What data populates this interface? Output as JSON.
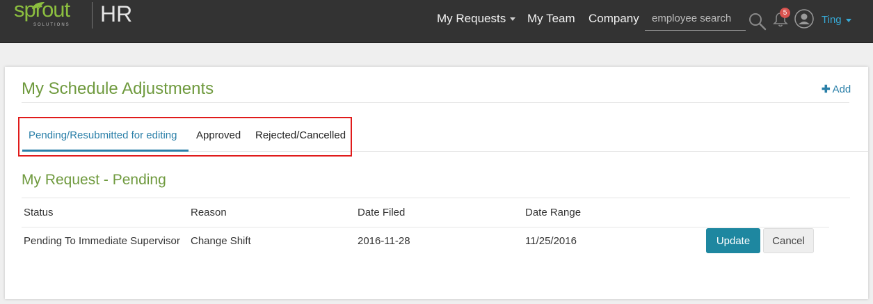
{
  "app": {
    "logo_text": "sprout",
    "logo_sub": "SOLUTIONS",
    "logo_product": "HR"
  },
  "nav": {
    "my_requests": "My Requests",
    "my_team": "My Team",
    "company": "Company",
    "search_placeholder": "employee search",
    "notification_count": "5",
    "user_name": "Ting"
  },
  "page": {
    "title": "My Schedule Adjustments",
    "add_label": "Add"
  },
  "tabs": [
    {
      "label": "Pending/Resubmitted for editing",
      "active": true
    },
    {
      "label": "Approved",
      "active": false
    },
    {
      "label": "Rejected/Cancelled",
      "active": false
    }
  ],
  "section": {
    "title": "My Request - Pending"
  },
  "table": {
    "columns": [
      "Status",
      "Reason",
      "Date Filed",
      "Date Range"
    ],
    "rows": [
      {
        "status": "Pending To Immediate Supervisor",
        "reason": "Change Shift",
        "date_filed": "2016-11-28",
        "date_range": "11/25/2016"
      }
    ],
    "update_label": "Update",
    "cancel_label": "Cancel"
  },
  "colors": {
    "topbar": "#333333",
    "brand_green": "#6f9a3e",
    "link_blue": "#2a7fa8",
    "button_teal": "#1e87a0",
    "highlight_red": "#e01b1b"
  }
}
